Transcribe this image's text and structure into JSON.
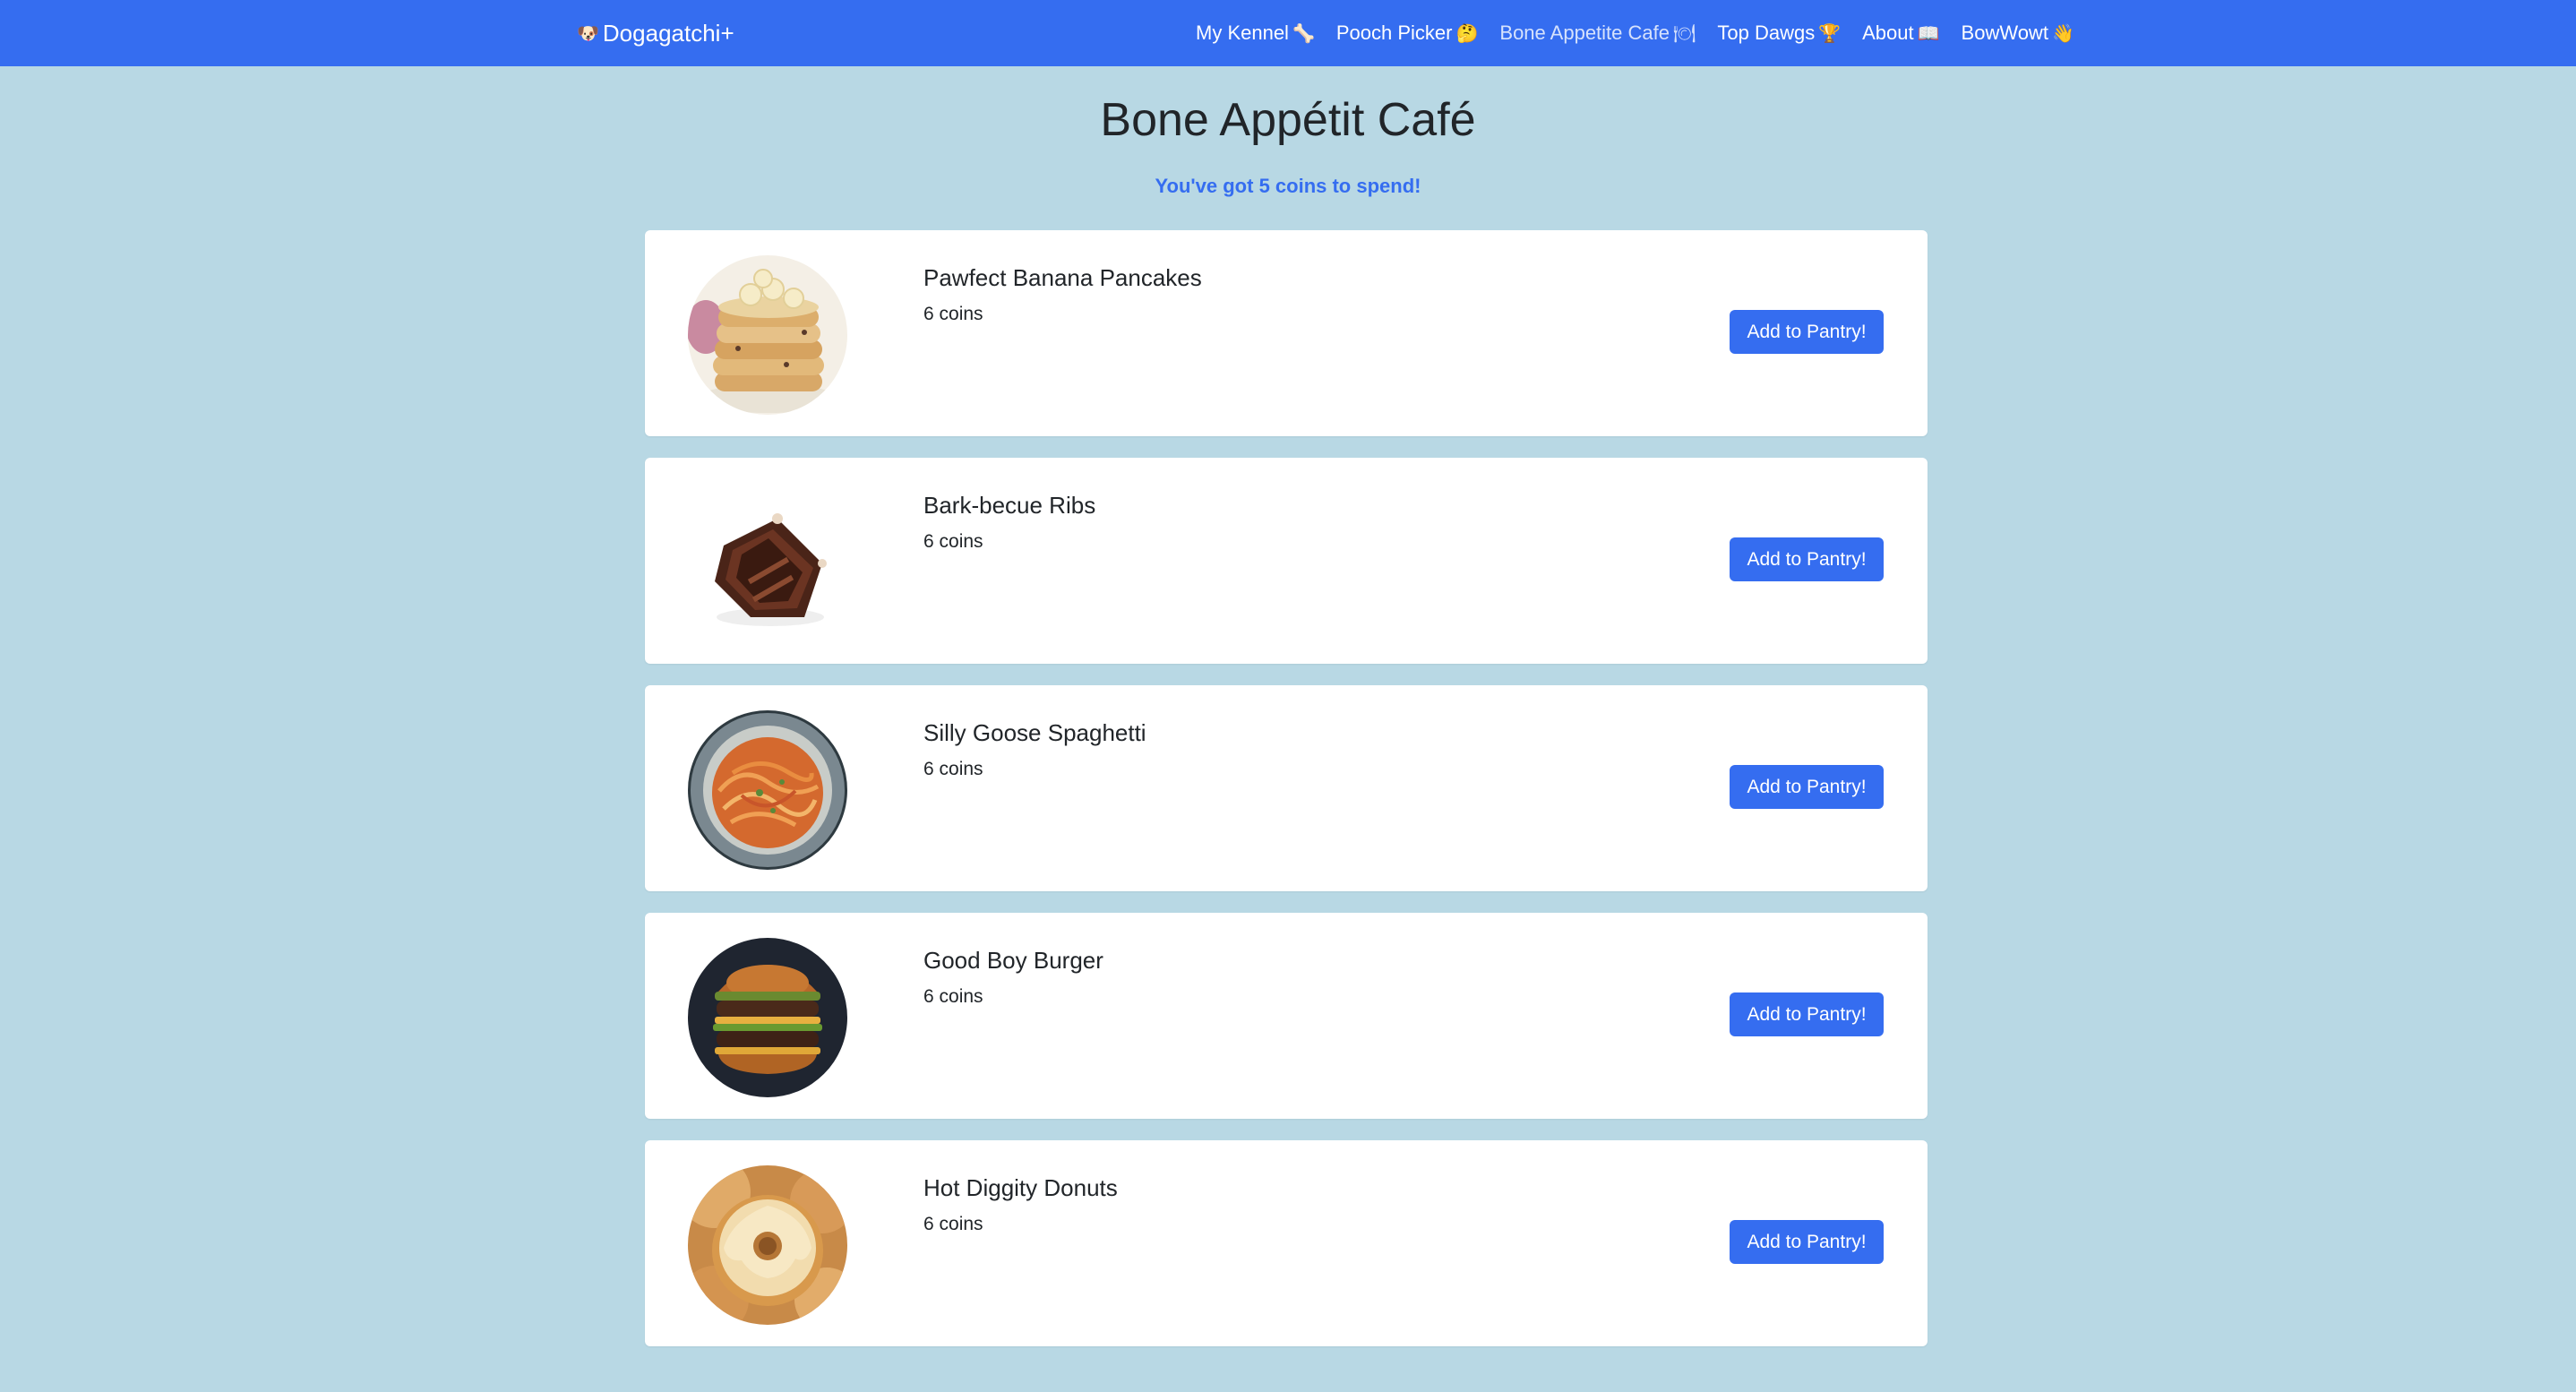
{
  "navbar": {
    "brand": {
      "icon": "dog-face-icon",
      "glyph": "🐶",
      "label": "Dogagatchi+"
    },
    "links": [
      {
        "label": "My Kennel",
        "icon": "bone-icon",
        "glyph": "🦴",
        "active": false
      },
      {
        "label": "Pooch Picker",
        "icon": "thinking-face-icon",
        "glyph": "🤔",
        "active": false
      },
      {
        "label": "Bone Appetite Cafe",
        "icon": "plate-icon",
        "glyph": "🍽",
        "active": true
      },
      {
        "label": "Top Dawgs",
        "icon": "trophy-icon",
        "glyph": "🏆",
        "active": false
      },
      {
        "label": "About",
        "icon": "book-icon",
        "glyph": "📖",
        "active": false
      },
      {
        "label": "BowWowt",
        "icon": "waving-hand-icon",
        "glyph": "👋",
        "active": false
      }
    ]
  },
  "page": {
    "title": "Bone Appétit Café",
    "coins_message": "You've got 5 coins to spend!"
  },
  "menu": [
    {
      "name": "Pawfect Banana Pancakes",
      "price": "6 coins",
      "button": "Add to Pantry!",
      "photo": "pancakes-photo"
    },
    {
      "name": "Bark-becue Ribs",
      "price": "6 coins",
      "button": "Add to Pantry!",
      "photo": "ribs-photo"
    },
    {
      "name": "Silly Goose Spaghetti",
      "price": "6 coins",
      "button": "Add to Pantry!",
      "photo": "spaghetti-photo"
    },
    {
      "name": "Good Boy Burger",
      "price": "6 coins",
      "button": "Add to Pantry!",
      "photo": "burger-photo"
    },
    {
      "name": "Hot Diggity Donuts",
      "price": "6 coins",
      "button": "Add to Pantry!",
      "photo": "donuts-photo"
    }
  ],
  "colors": {
    "navbar": "#356df0",
    "background": "#b8d8e4",
    "accent": "#356df0"
  }
}
